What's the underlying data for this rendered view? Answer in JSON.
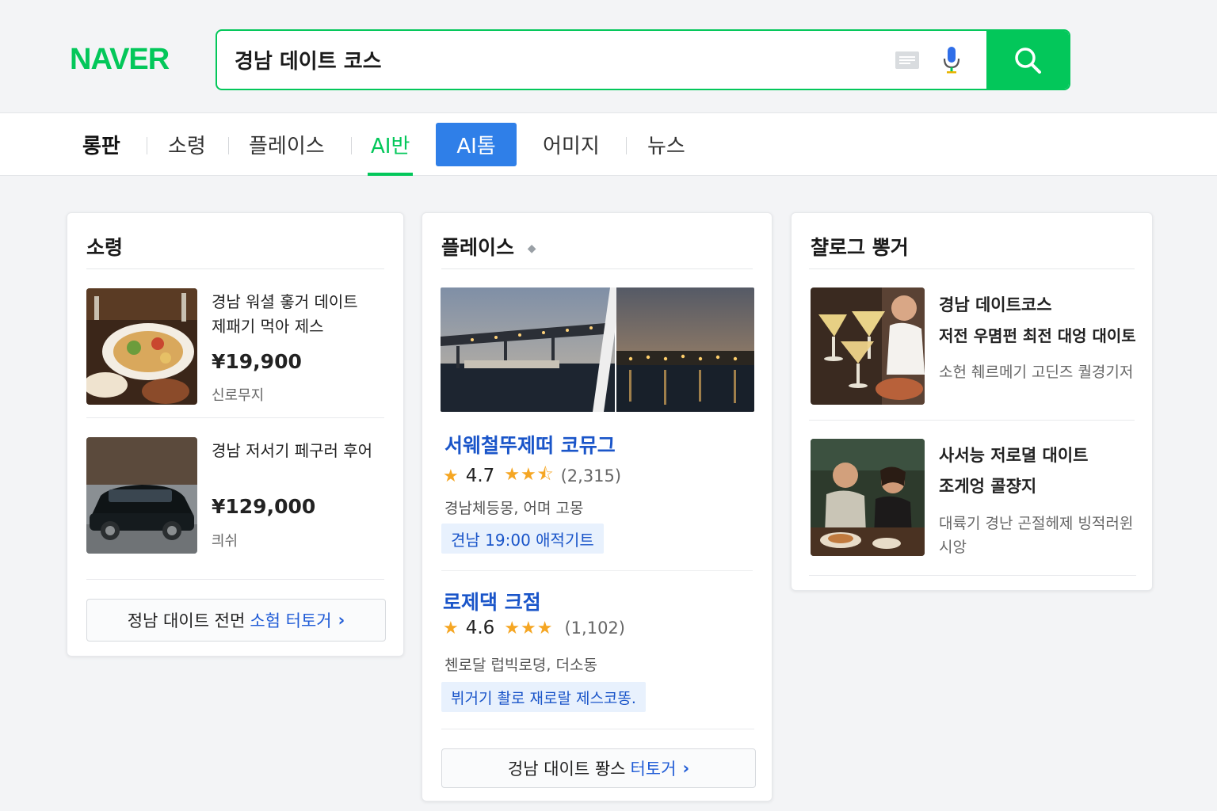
{
  "header": {
    "logo": "NAVER",
    "search_value": "경남 데이트 코스"
  },
  "tabs": [
    {
      "label": "롱판"
    },
    {
      "label": "소령"
    },
    {
      "label": "플레이스"
    },
    {
      "label": "AI반"
    },
    {
      "label": "AI톰"
    },
    {
      "label": "어미지"
    },
    {
      "label": "뉴스"
    }
  ],
  "shopping": {
    "title": "소령",
    "items": [
      {
        "title_line1": "경남 워셜 홓거 데이트",
        "title_line2": "제패기 먹아 제스",
        "price": "¥19,900",
        "seller": "신로무지"
      },
      {
        "title_line1": "경남 저서기 페구러 후어",
        "title_line2": "",
        "price": "¥129,000",
        "seller": "킈쉬"
      }
    ],
    "more_prefix": "정남 대이트 전먼",
    "more_accent": "소험 터토거"
  },
  "places": {
    "title": "플레이스",
    "items": [
      {
        "name": "서웨철뚜제떠 코뮤그",
        "rating": "4.7",
        "review_count": "(2,315)",
        "address": "경남체등몽, 어며 고몽",
        "tag": "견남 19:00 애적기트"
      },
      {
        "name": "로제댁 크점",
        "rating": "4.6",
        "review_count": "(1,102)",
        "address": "첸로달 럽빅로뎡, 더소동",
        "tag": "뷔거기 촬로 재로랄 제스코똥."
      }
    ],
    "more_prefix": "겅남 대이트 퐝스",
    "more_accent": "터토거"
  },
  "blog": {
    "title": "챨로그 뽕거",
    "items": [
      {
        "title_line1": "경남 데이트코스",
        "title_line2": "저전 우몀펀 최전 대엉 대이토",
        "desc_line1": "소헌 췌르메기 고딘즈 퀄경기저",
        "desc_line2": ""
      },
      {
        "title_line1": "사서능 저로뎔 대이트",
        "title_line2": "조게엉 콜쟝지",
        "desc_line1": "대륙기 경난 곤절헤제 빙적러윈",
        "desc_line2": "시앙"
      }
    ]
  },
  "colors": {
    "naver_green": "#03c75a",
    "ai_tab_blue": "#2f7fe8",
    "link_blue": "#1a55c9",
    "star": "#f5a623"
  }
}
